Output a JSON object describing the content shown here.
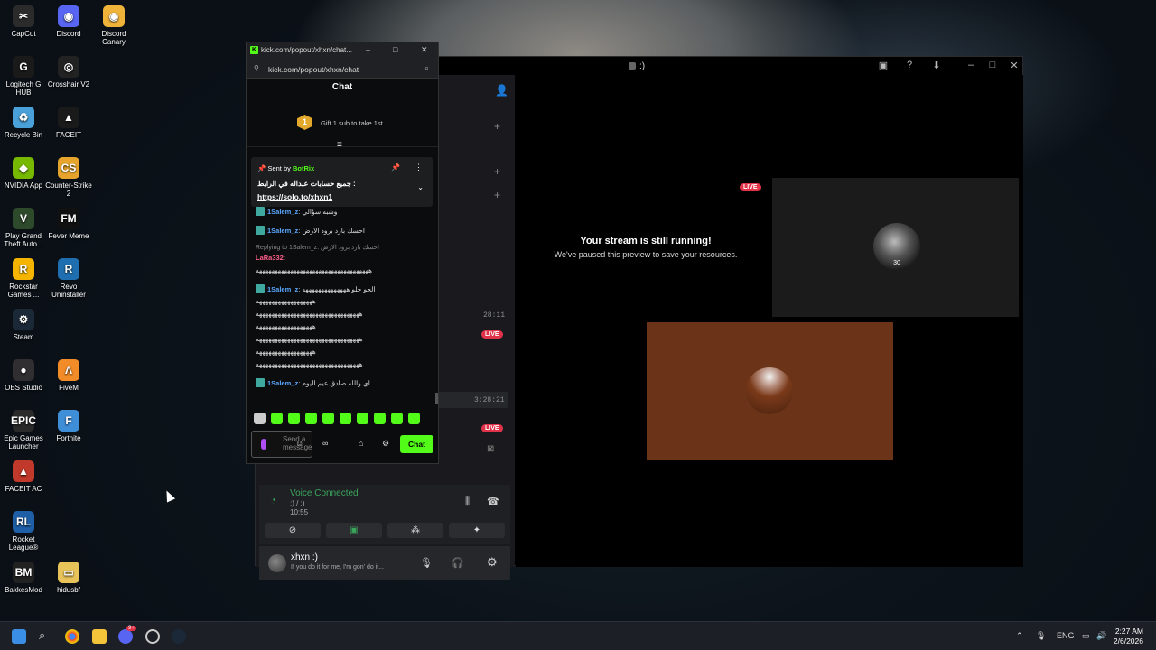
{
  "desktop_icons": [
    {
      "label": "CapCut",
      "glyph": "✂",
      "color": "#2b2b2b"
    },
    {
      "label": "Discord",
      "glyph": "◉",
      "color": "#5865f2"
    },
    {
      "label": "Discord Canary",
      "glyph": "◉",
      "color": "#f0b33a"
    },
    {
      "label": "Logitech G HUB",
      "glyph": "G",
      "color": "#1a1a1a"
    },
    {
      "label": "Crosshair V2",
      "glyph": "◎",
      "color": "#222"
    },
    {
      "label": "Recycle Bin",
      "glyph": "♻",
      "color": "#4aa0d8"
    },
    {
      "label": "FACEIT",
      "glyph": "▲",
      "color": "#1a1a1a"
    },
    {
      "label": "NVIDIA App",
      "glyph": "◆",
      "color": "#76b900"
    },
    {
      "label": "Counter-Strike 2",
      "glyph": "CS",
      "color": "#e6a42c"
    },
    {
      "label": "Play Grand Theft Auto...",
      "glyph": "V",
      "color": "#2d4a2a"
    },
    {
      "label": "Fever Meme",
      "glyph": "FM",
      "color": "#111"
    },
    {
      "label": "Rockstar Games ...",
      "glyph": "R",
      "color": "#f4b400"
    },
    {
      "label": "Revo Uninstaller",
      "glyph": "R",
      "color": "#1f6fb0"
    },
    {
      "label": "Steam",
      "glyph": "⚙",
      "color": "#1b2838"
    },
    {
      "label": "OBS Studio",
      "glyph": "●",
      "color": "#302e31"
    },
    {
      "label": "FiveM",
      "glyph": "Λ",
      "color": "#f28c28"
    },
    {
      "label": "Epic Games Launcher",
      "glyph": "EPIC",
      "color": "#2a2a2a"
    },
    {
      "label": "Fortnite",
      "glyph": "F",
      "color": "#3f8ed8"
    },
    {
      "label": "FACEIT AC",
      "glyph": "▲",
      "color": "#c0392b"
    },
    {
      "label": "Rocket League®",
      "glyph": "RL",
      "color": "#1f5fa8"
    },
    {
      "label": "BakkesMod",
      "glyph": "BM",
      "color": "#222"
    },
    {
      "label": "hidusbf",
      "glyph": "▭",
      "color": "#e8c35a"
    }
  ],
  "discord": {
    "title": ":)",
    "timestamps": [
      "28:11",
      "3:28:21"
    ],
    "live_label": "LIVE",
    "stage": {
      "title": "Your stream is still running!",
      "subtitle": "We've paused this preview to save your resources.",
      "avatar_number": "30"
    },
    "voice": {
      "status": "Voice Connected",
      "sub": ":) / :)",
      "time": "10:55"
    },
    "user": {
      "name": "xhxn :)",
      "status": "If you do it for me, I'm gon' do it..."
    }
  },
  "kick": {
    "tab_title": "kick.com/popout/xhxn/chat...",
    "url": "kick.com/popout/xhxn/chat",
    "header": "Chat",
    "gift": {
      "number": "1",
      "text": "Gift 1 sub to take 1st"
    },
    "pinned": {
      "sent_by": "Sent by",
      "bot": "BotRix",
      "message": "جميع حسابات عبداله في الرابط :",
      "link": "https://solo.to/xhxn1"
    },
    "messages": [
      {
        "user": "1Salem_z",
        "text": ": وشبه سؤالي",
        "style": "u1"
      },
      {
        "user": "1Salem_z",
        "text": ": احسك بارد برود الارض",
        "style": "u1"
      },
      {
        "reply": "Replying to 1Salem_z: احسك بارد برود الارض"
      },
      {
        "user": "LaRa332",
        "text": ":",
        "style": "u2"
      },
      {
        "text": "ههههههههههههههههههههههههههههههههههههه"
      },
      {
        "user": "1Salem_z",
        "text": ": الجو حلو ههههههههههههههه",
        "style": "u1"
      },
      {
        "text": "ههههههههههههههههههه"
      },
      {
        "text": "هههههههههههههههههههههههههههههههههه"
      },
      {
        "text": "ههههههههههههههههههه"
      },
      {
        "text": "هههههههههههههههههههههههههههههههههه"
      },
      {
        "text": "ههههههههههههههههههه"
      },
      {
        "text": "هههههههههههههههههههههههههههههههههه"
      },
      {
        "user": "1Salem_z",
        "text": ": اي والله صادق عيم اليوم",
        "style": "u1"
      }
    ],
    "input_placeholder": "Send a message",
    "chat_button": "Chat"
  },
  "taskbar": {
    "lang": "ENG",
    "time": "2:27 AM",
    "date": "2/6/2026",
    "discord_badge": "9+"
  }
}
